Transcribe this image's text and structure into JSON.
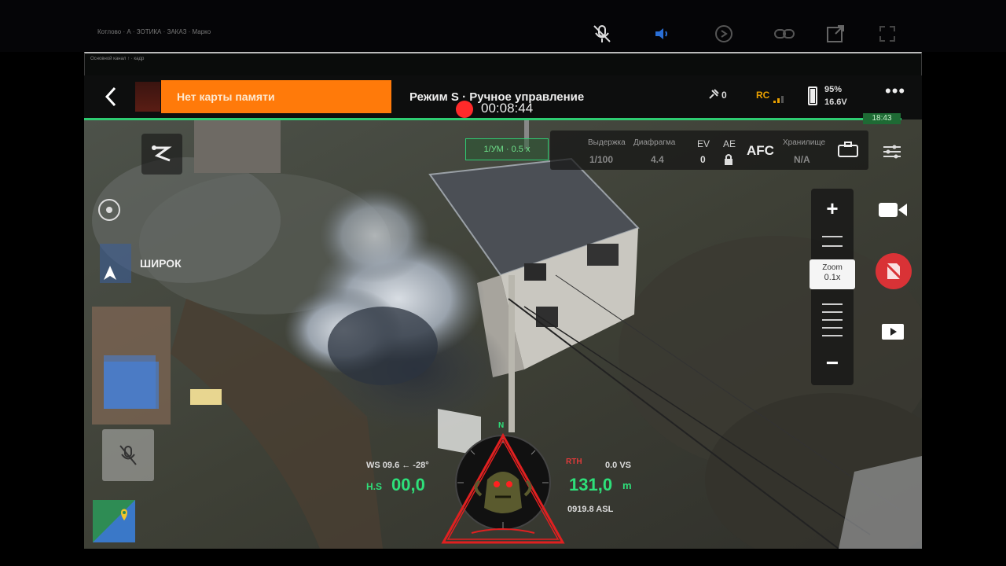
{
  "outer": {
    "title": "Котлово · А · ЗОТИКА · ЗАКАЗ · Марко",
    "icons": [
      "mic-off-icon",
      "speaker-icon",
      "clock-icon",
      "link-icon",
      "open-external-icon",
      "fullscreen-icon"
    ]
  },
  "frame": {
    "caption": "Основной канал ↑ · кадр"
  },
  "topbar": {
    "warning": "Нет карты памяти",
    "mode": "Режим S · Ручное управление",
    "record_time": "00:08:44",
    "satellites": "0",
    "rc_label": "RC",
    "battery_percent": "95%",
    "battery_voltage": "16.6V",
    "time_badge": "18:43"
  },
  "camera": {
    "focus_badge": "1/УМ · 0.5 x",
    "shutter_label": "Выдержка",
    "shutter_value": "1/100",
    "aperture_label": "Диафрагма",
    "aperture_value": "4.4",
    "ev_label": "EV",
    "ev_value": "0",
    "ae_label": "AE",
    "afc": "AFC",
    "storage_label": "Хранилище",
    "storage_value": "N/A"
  },
  "left": {
    "wide_label": "ШИРОК"
  },
  "zoom": {
    "label": "Zoom",
    "value": "0.1x"
  },
  "osd": {
    "ws": "WS 09.6 ← -28°",
    "hs_label": "H.S",
    "hs_value": "00,0",
    "vs": "0.0 VS",
    "alt_value": "131,0",
    "alt_unit": "m",
    "asl": "0919.8 ASL",
    "red_label": "RTH",
    "compass_n": "N"
  },
  "colors": {
    "accent_green": "#2ecc71",
    "warning_orange": "#ff7a0a",
    "record_red": "#ff2a2a",
    "emblem_red": "#e02020"
  }
}
